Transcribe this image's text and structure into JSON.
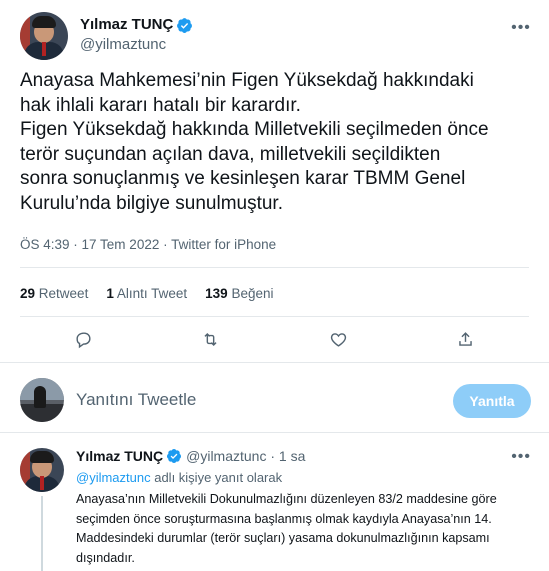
{
  "tweet": {
    "author": {
      "name": "Yılmaz TUNÇ",
      "handle": "@yilmaztunc",
      "verified": true
    },
    "text": "Anayasa Mahkemesi’nin Figen Yüksekdağ hakkındaki\nhak ihlali kararı hatalı bir karardır.\nFigen Yüksekdağ hakkında Milletvekili seçilmeden önce\nterör suçundan açılan dava, milletvekili seçildikten\nsonra sonuçlanmış ve kesinleşen karar TBMM Genel\nKurulu’nda bilgiye sunulmuştur.",
    "meta": "ÖS 4:39 · 17 Tem 2022 · Twitter for iPhone",
    "stats": {
      "retweets_count": "29",
      "retweets_label": "Retweet",
      "quotes_count": "1",
      "quotes_label": "Alıntı Tweet",
      "likes_count": "139",
      "likes_label": "Beğeni"
    }
  },
  "reply_box": {
    "placeholder": "Yanıtını Tweetle",
    "button_label": "Yanıtla"
  },
  "reply": {
    "name": "Yılmaz TUNÇ",
    "handle_time": "@yilmaztunc · 1 sa",
    "replying_mention": "@yilmaztunc",
    "replying_suffix": " adlı kişiye yanıt olarak",
    "text": "Anayasa’nın Milletvekili Dokunulmazlığını düzenleyen 83/2 maddesine göre\nseçimden önce soruşturmasına başlanmış olmak kaydıyla Anayasa’nın 14.\nMaddesindeki durumlar (terör suçları) yasama dokunulmazlığının kapsamı\ndışındadır."
  },
  "icons": [
    "verified-icon",
    "more-icon",
    "reply-icon",
    "retweet-icon",
    "like-icon",
    "share-icon"
  ],
  "colors": {
    "accent": "#1d9bf0",
    "reply_button": "#8ecdf8",
    "secondary_text": "#536471",
    "divider": "#e4e8eb"
  }
}
